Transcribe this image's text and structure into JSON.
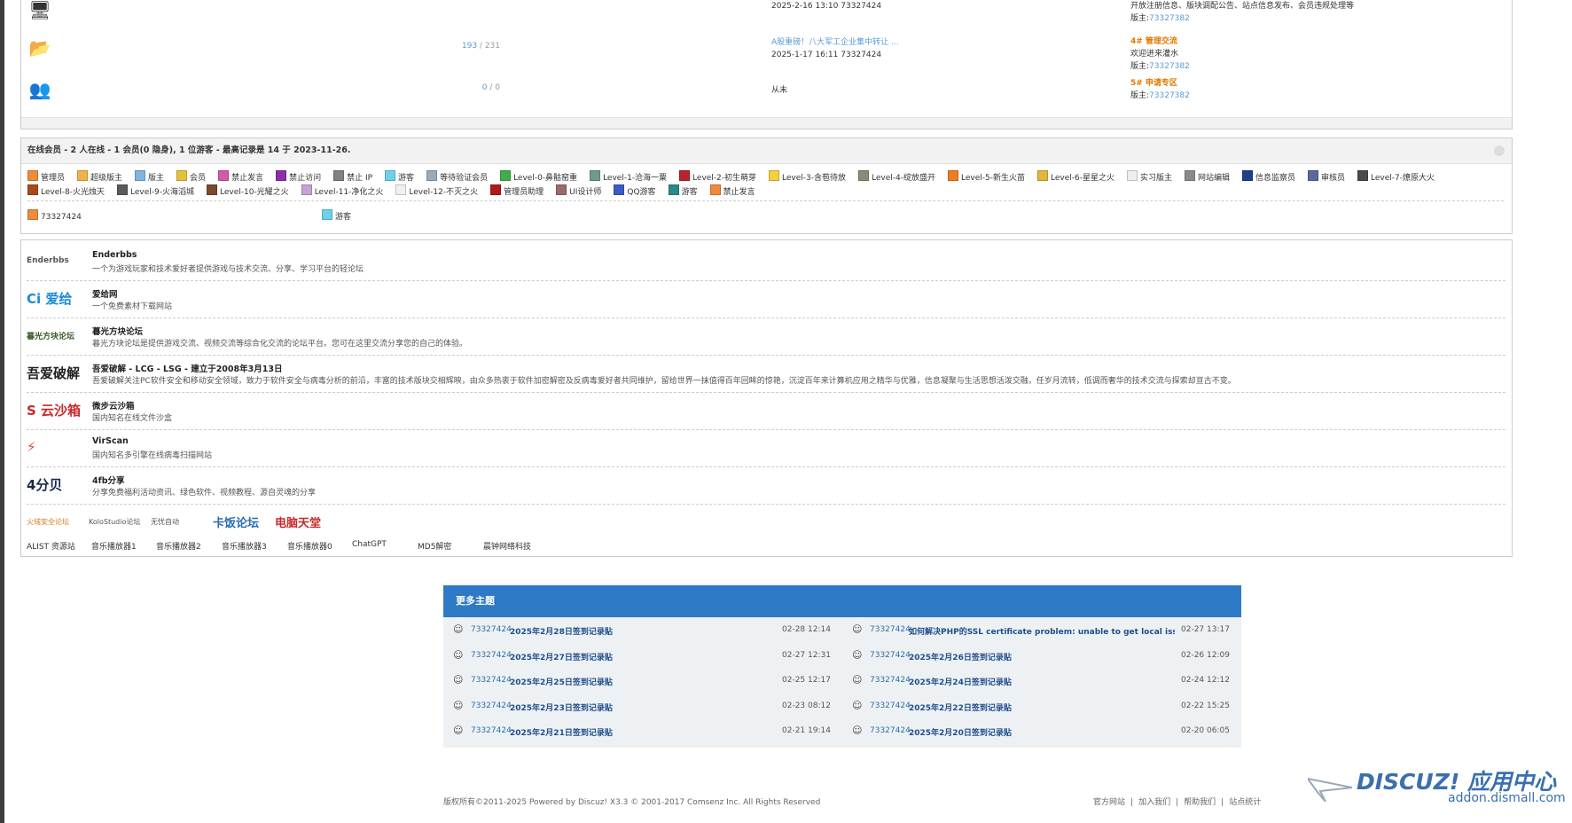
{
  "forums": [
    {
      "icon": "forum-computer-icon",
      "count_posts": "",
      "count_total": "",
      "last_line1": "",
      "last_line2": "2025-2-16 13:10 73327424",
      "mod_sub": "",
      "mod_desc": "开放注册信息、版块调配公告、站点信息发布、会员违规处理等",
      "mod_label": "版主:",
      "mod_user": "73327382"
    },
    {
      "icon": "forum-folder-icon",
      "count_posts": "193",
      "count_total": "231",
      "last_line1": "A股重磅！八大军工企业集中转让 ...",
      "last_line2": "2025-1-17 16:11 73327424",
      "mod_sub": "4# 管理交流",
      "mod_desc": "欢迎进来灌水",
      "mod_label": "版主:",
      "mod_user": "73327382"
    },
    {
      "icon": "forum-users-icon",
      "count_posts": "0",
      "count_total": "0",
      "last_line1": "",
      "last_line2": "从未",
      "mod_sub": "5# 申请专区",
      "mod_desc": "",
      "mod_label": "版主:",
      "mod_user": "73327382"
    }
  ],
  "online": {
    "header": "在线会员 - 2 人在线 - 1 会员(0 隐身), 1 位游客 - 最高记录是 14 于 2023-11-26.",
    "groups": [
      {
        "label": "管理员",
        "color": "#f08a3c"
      },
      {
        "label": "超级版主",
        "color": "#f2b24a"
      },
      {
        "label": "版主",
        "color": "#7fb5e0"
      },
      {
        "label": "会员",
        "color": "#e3c23a"
      },
      {
        "label": "禁止发言",
        "color": "#d45aa8"
      },
      {
        "label": "禁止访问",
        "color": "#8c2ea8"
      },
      {
        "label": "禁止 IP",
        "color": "#808080"
      },
      {
        "label": "游客",
        "color": "#6fd1e8"
      },
      {
        "label": "等待验证会员",
        "color": "#9aaab8"
      },
      {
        "label": "Level-0-鼻骷窑重",
        "color": "#3fae49"
      },
      {
        "label": "Level-1-沧海一粟",
        "color": "#6f9a8a"
      },
      {
        "label": "Level-2-初生萌芽",
        "color": "#b8242c"
      },
      {
        "label": "Level-3-含苞待放",
        "color": "#f4d03f"
      },
      {
        "label": "Level-4-绽放盛开",
        "color": "#8a8a7a"
      },
      {
        "label": "Level-5-新生火苗",
        "color": "#f07c1f"
      },
      {
        "label": "Level-6-星星之火",
        "color": "#e3b53a"
      },
      {
        "label": "实习版主",
        "color": "#eeeeee"
      },
      {
        "label": "网站编辑",
        "color": "#8a8a8a"
      },
      {
        "label": "信息监察员",
        "color": "#1e3f8a"
      },
      {
        "label": "审核员",
        "color": "#5a6a9a"
      },
      {
        "label": "Level-7-燎原大火",
        "color": "#4a4a4a"
      },
      {
        "label": "Level-8-火光烛天",
        "color": "#a84a1a"
      },
      {
        "label": "Level-9-火海滔城",
        "color": "#5a5a5a"
      },
      {
        "label": "Level-10-光耀之火",
        "color": "#7a4a2a"
      },
      {
        "label": "Level-11-净化之火",
        "color": "#c8a0d8"
      },
      {
        "label": "Level-12-不灭之火",
        "color": "#f0f0f0"
      },
      {
        "label": "管理员助理",
        "color": "#b01a1a"
      },
      {
        "label": "UI设计师",
        "color": "#9a6a6a"
      },
      {
        "label": "QQ游客",
        "color": "#3a5ac8"
      },
      {
        "label": "游客",
        "color": "#2a8a8a"
      },
      {
        "label": "禁止发言",
        "color": "#f08a3c"
      }
    ],
    "users": [
      {
        "name": "73327424",
        "color": "#f08a3c"
      },
      {
        "name": "游客",
        "color": "#6fd1e8"
      }
    ]
  },
  "links": [
    {
      "logo": "Enderbbs",
      "logo_color": "#555555",
      "name": "Enderbbs",
      "desc": "一个为游戏玩家和技术爱好者提供游戏与技术交流、分享、学习平台的轻论坛"
    },
    {
      "logo": "Ci 爱给",
      "logo_color": "#1a8ad8",
      "name": "爱给网",
      "desc": "一个免费素材下载网站"
    },
    {
      "logo": "暮光方块论坛",
      "logo_color": "#3a5a2a",
      "name": "暮光方块论坛",
      "desc": "暮光方块论坛是提供游戏交流、视频交流等综合化交流的论坛平台。您可在这里交流分享您的自己的体验。"
    },
    {
      "logo": "吾爱破解",
      "logo_color": "#222222",
      "name": "吾爱破解 - LCG - LSG - 建立于2008年3月13日",
      "desc": "吾爱破解关注PC软件安全和移动安全领域，致力于软件安全与病毒分析的前沿，丰富的技术版块交相辉映，由众多热衷于软件加密解密及反病毒爱好者共同维护，留给世界一抹值得百年回眸的惊艳，沉淀百年来计算机应用之精华与优雅，信息凝聚与生活思想活泼交融，任岁月流转，低调而奢华的技术交流与探索却亘古不变。"
    },
    {
      "logo": "S 云沙箱",
      "logo_color": "#c8282c",
      "name": "微步云沙箱",
      "desc": "国内知名在线文件沙盒"
    },
    {
      "logo": "⚡",
      "logo_color": "#d84a3a",
      "name": "VirScan",
      "desc": "国内知名多引擎在线病毒扫描网站"
    },
    {
      "logo": "4分贝",
      "logo_color": "#1a2a4a",
      "name": "4fb分享",
      "desc": "分享免费福利活动资讯、绿色软件、视频教程、源自灵魂的分享"
    }
  ],
  "image_links": [
    "火绒安全论坛",
    "KoloStudio论坛",
    "无忧自动",
    "卡饭论坛",
    "电脑天堂"
  ],
  "text_links": [
    "ALIST 资源站",
    "音乐播放器1",
    "音乐播放器2",
    "音乐播放器3",
    "音乐播放器0",
    "ChatGPT",
    "MD5解密",
    "晨钟网络科技"
  ],
  "more_topics": {
    "title": "更多主题",
    "items": [
      {
        "user": "73327424",
        "title": "2025年2月28日签到记录贴",
        "date": "02-28 12:14"
      },
      {
        "user": "73327424",
        "title": "如何解决PHP的SSL certificate problem: unable to get local issuer ce",
        "date": "02-27 13:17"
      },
      {
        "user": "73327424",
        "title": "2025年2月27日签到记录贴",
        "date": "02-27 12:31"
      },
      {
        "user": "73327424",
        "title": "2025年2月26日签到记录贴",
        "date": "02-26 12:09"
      },
      {
        "user": "73327424",
        "title": "2025年2月25日签到记录贴",
        "date": "02-25 12:17"
      },
      {
        "user": "73327424",
        "title": "2025年2月24日签到记录贴",
        "date": "02-24 12:12"
      },
      {
        "user": "73327424",
        "title": "2025年2月23日签到记录贴",
        "date": "02-23 08:12"
      },
      {
        "user": "73327424",
        "title": "2025年2月22日签到记录贴",
        "date": "02-22 15:25"
      },
      {
        "user": "73327424",
        "title": "2025年2月21日签到记录贴",
        "date": "02-21 19:14"
      },
      {
        "user": "73327424",
        "title": "2025年2月20日签到记录贴",
        "date": "02-20 06:05"
      }
    ]
  },
  "footer": {
    "copyright": "版权所有©2011-2025 Powered by Discuz! X3.3 © 2001-2017 Comsenz Inc. All Rights Reserved",
    "links": [
      "官方网站",
      "加入我们",
      "帮助我们",
      "站点统计"
    ],
    "brand_main": "DISCUZ! 应用中心",
    "brand_sub": "addon.dismall.com"
  }
}
